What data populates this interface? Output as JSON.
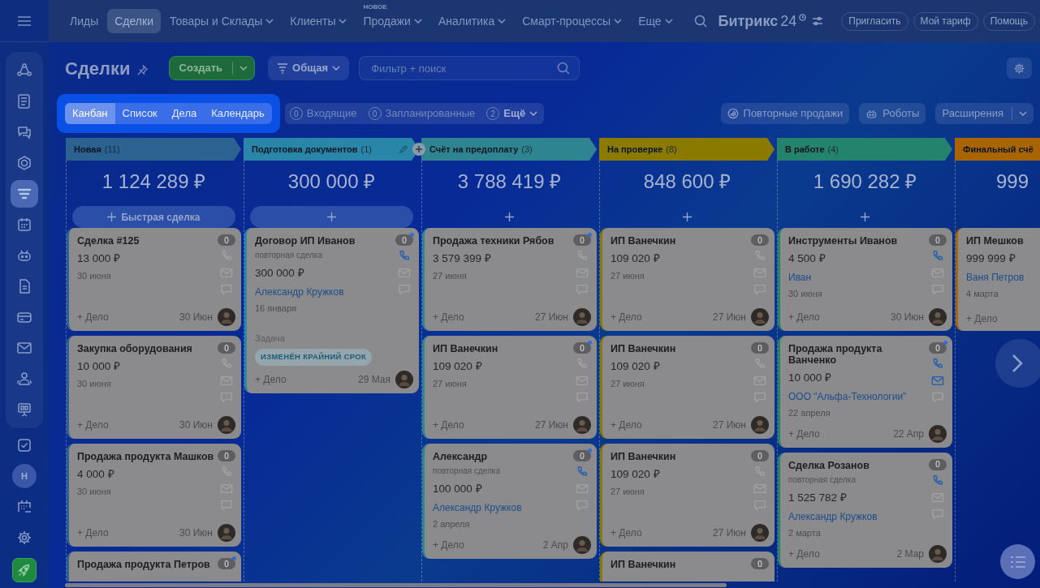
{
  "sidebar": {
    "items": [
      {
        "kind": "flow",
        "selected": false
      },
      {
        "kind": "news",
        "selected": false
      },
      {
        "kind": "chats",
        "selected": false
      },
      {
        "kind": "hexagon",
        "selected": false
      },
      {
        "kind": "funnel",
        "selected": true
      },
      {
        "kind": "calendar",
        "selected": false
      },
      {
        "kind": "robot",
        "selected": false
      },
      {
        "kind": "document",
        "selected": false
      },
      {
        "kind": "card",
        "selected": false
      },
      {
        "kind": "mail",
        "selected": false
      },
      {
        "kind": "people",
        "selected": false
      },
      {
        "kind": "board",
        "selected": false
      },
      {
        "kind": "check",
        "selected": false
      },
      {
        "kind": "avatar",
        "label": "Н",
        "selected": false
      },
      {
        "kind": "schedule",
        "selected": false
      },
      {
        "kind": "gear",
        "selected": false
      },
      {
        "kind": "rocket",
        "selected": false
      }
    ]
  },
  "top_nav": {
    "items": [
      {
        "label": "Лиды",
        "selected": false,
        "dropdown": false
      },
      {
        "label": "Сделки",
        "selected": true,
        "dropdown": false
      },
      {
        "label": "Товары и Склады",
        "selected": false,
        "dropdown": true
      },
      {
        "label": "Клиенты",
        "selected": false,
        "dropdown": true
      },
      {
        "label": "Продажи",
        "badge": "НОВОЕ",
        "selected": false,
        "dropdown": true
      },
      {
        "label": "Аналитика",
        "selected": false,
        "dropdown": true
      },
      {
        "label": "Смарт-процессы",
        "selected": false,
        "dropdown": true
      },
      {
        "label": "Еще",
        "selected": false,
        "dropdown": true
      }
    ],
    "logo": "Битрикс",
    "logo_number": "24",
    "buttons": [
      "Пригласить",
      "Мой тариф",
      "Помощь"
    ]
  },
  "page_title": "Сделки",
  "create_button": "Создать",
  "category_button": "Общая",
  "search": {
    "placeholder": "Фильтр + поиск"
  },
  "views": [
    {
      "label": "Канбан",
      "selected": true
    },
    {
      "label": "Список",
      "selected": false
    },
    {
      "label": "Дела",
      "selected": false
    },
    {
      "label": "Календарь",
      "selected": false
    }
  ],
  "counters": [
    {
      "count": "0",
      "label": "Входящие",
      "dropdown": false
    },
    {
      "count": "0",
      "label": "Запланированные",
      "dropdown": false
    },
    {
      "count": "2",
      "label": "Ещё",
      "dropdown": true
    }
  ],
  "right_buttons": [
    {
      "kind": "repeat",
      "label": "Повторные продажи"
    },
    {
      "kind": "robot",
      "label": "Роботы"
    },
    {
      "kind": "split",
      "label": "Расширения"
    }
  ],
  "columns": [
    {
      "title": "Новая",
      "count": "(11)",
      "color": "#2b6290",
      "total": "1 124 289 ₽",
      "quick_add": {
        "label": "Быстрая сделка",
        "filled": true
      },
      "cards": [
        {
          "title": "Сделка #125",
          "amount": "13 000 ₽",
          "date": "30 июня",
          "action": "+ Дело",
          "due": "30 Июн",
          "counter": "0",
          "new": false,
          "phone": false,
          "mail": false
        },
        {
          "title": "Закупка оборудования",
          "amount": "10 000 ₽",
          "date": "30 июня",
          "action": "+ Дело",
          "due": "30 Июн",
          "counter": "0",
          "new": false,
          "phone": false,
          "mail": false
        },
        {
          "title": "Продажа продукта Машков",
          "amount": "4 000 ₽",
          "date": "30 июня",
          "action": "+ Дело",
          "due": "30 Июн",
          "counter": "0",
          "new": false,
          "phone": false,
          "mail": false
        },
        {
          "title": "Продажа продукта Петров",
          "counter": "0",
          "new": true
        }
      ]
    },
    {
      "title": "Подготовка документов",
      "count": "(1)",
      "color": "#2a86a8",
      "editable": true,
      "total": "300 000 ₽",
      "quick_add": {
        "filled": true
      },
      "cards": [
        {
          "title": "Договор ИП Иванов",
          "subtitle": "повторная сделка",
          "amount": "300 000 ₽",
          "contact": "Александр Кружков",
          "date": "16 января",
          "task": {
            "label": "Задача",
            "tag": "ИЗМЕНЁН КРАЙНИЙ СРОК"
          },
          "action": "+ Дело",
          "due": "29 Мая",
          "counter": "0",
          "new": true,
          "phone": true,
          "mail": false
        }
      ]
    },
    {
      "title": "Счёт на предоплату",
      "count": "(3)",
      "color": "#2e8490",
      "total": "3 788 419 ₽",
      "quick_add": {
        "filled": false
      },
      "cards": [
        {
          "title": "Продажа техники Рябов",
          "amount": "3 579 399 ₽",
          "date": "27 июня",
          "action": "+ Дело",
          "due": "27 Июн",
          "counter": "0",
          "new": true,
          "phone": false,
          "mail": false
        },
        {
          "title": "ИП Ванечкин",
          "amount": "109 020 ₽",
          "date": "27 июня",
          "action": "+ Дело",
          "due": "27 Июн",
          "counter": "0",
          "new": true,
          "phone": false,
          "mail": false
        },
        {
          "title": "Александр",
          "subtitle": "повторная сделка",
          "amount": "100 000 ₽",
          "contact": "Александр Кружков",
          "date": "2 апреля",
          "action": "+ Дело",
          "due": "2 Апр",
          "counter": "0",
          "new": true,
          "phone": true,
          "mail": false
        }
      ]
    },
    {
      "title": "На проверке",
      "count": "(8)",
      "color": "#8a7a00",
      "total": "848 600 ₽",
      "quick_add": {
        "filled": false
      },
      "cards": [
        {
          "title": "ИП Ванечкин",
          "amount": "109 020 ₽",
          "date": "27 июня",
          "action": "+ Дело",
          "due": "27 Июн",
          "counter": "0",
          "new": false,
          "phone": false,
          "mail": false
        },
        {
          "title": "ИП Ванечкин",
          "amount": "109 020 ₽",
          "date": "27 июня",
          "action": "+ Дело",
          "due": "27 Июн",
          "counter": "0",
          "new": false,
          "phone": false,
          "mail": false
        },
        {
          "title": "ИП Ванечкин",
          "amount": "109 020 ₽",
          "date": "27 июня",
          "action": "+ Дело",
          "due": "27 Июн",
          "counter": "0",
          "new": false,
          "phone": false,
          "mail": false
        },
        {
          "title": "ИП Ванечкин",
          "counter": "0",
          "new": false
        }
      ]
    },
    {
      "title": "В работе",
      "count": "(4)",
      "color": "#24836c",
      "total": "1 690 282 ₽",
      "quick_add": {
        "filled": false
      },
      "cards": [
        {
          "title": "Инструменты Иванов",
          "amount": "4 500 ₽",
          "contact": "Иван",
          "date": "30 июня",
          "action": "+ Дело",
          "due": "30 Июн",
          "counter": "0",
          "new": false,
          "phone": true,
          "mail": false
        },
        {
          "title": "Продажа продукта Ванченко",
          "amount": "10 000 ₽",
          "contact": "ООО \"Альфа-Технологии\"",
          "date": "22 апреля",
          "action": "+ Дело",
          "due": "22 Апр",
          "counter": "0",
          "new": true,
          "phone": true,
          "mail": true
        },
        {
          "title": "Сделка Розанов",
          "subtitle": "повторная сделка",
          "amount": "1 525 782 ₽",
          "contact": "Александр Кружков",
          "date": "2 марта",
          "action": "+ Дело",
          "due": "2 Мар",
          "counter": "0",
          "new": false,
          "phone": true,
          "mail": false
        }
      ]
    },
    {
      "title": "Финальный счё",
      "color": "#a86400",
      "total": "999",
      "cards": [
        {
          "title": "ИП Мешков",
          "amount": "999 999 ₽",
          "contact": "Ваня Петров",
          "date": "4 марта",
          "action": "+ Дело"
        }
      ]
    }
  ]
}
